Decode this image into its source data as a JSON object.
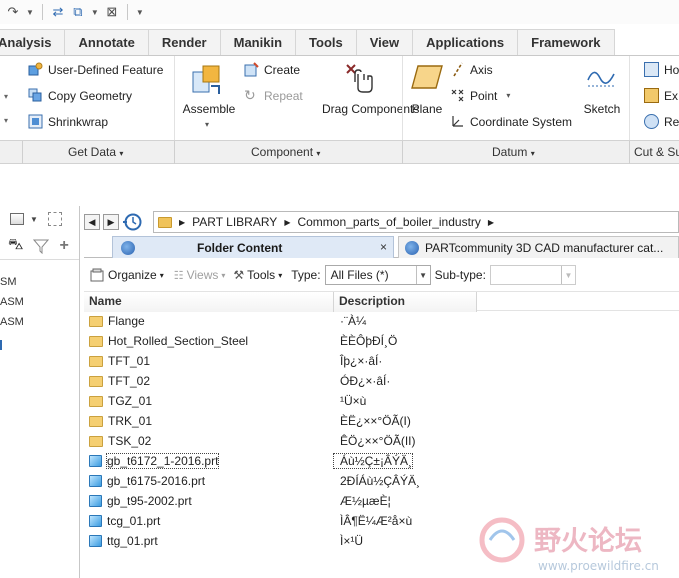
{
  "ribbon_tabs": [
    "Analysis",
    "Annotate",
    "Render",
    "Manikin",
    "Tools",
    "View",
    "Applications",
    "Framework"
  ],
  "ribbon": {
    "get_data": [
      "User-Defined Feature",
      "Copy Geometry",
      "Shrinkwrap"
    ],
    "assemble": "Assemble",
    "create": "Create",
    "repeat": "Repeat",
    "drag_components": "Drag Components",
    "plane": "Plane",
    "axis": "Axis",
    "point": "Point",
    "coordinate_system": "Coordinate System",
    "sketch": "Sketch",
    "right_items": [
      "Ho",
      "Ex",
      "Re"
    ]
  },
  "groups": {
    "get_data": "Get Data",
    "component": "Component",
    "datum": "Datum",
    "cut_surface": "Cut & Su"
  },
  "left_panel": {
    "items": [
      "SM",
      "ASM",
      "ASM"
    ]
  },
  "nav": {
    "path": [
      "PART LIBRARY",
      "Common_parts_of_boiler_industry"
    ]
  },
  "browser_tabs": {
    "tab1": "Folder Content",
    "tab1_close": "×",
    "tab2": "PARTcommunity 3D CAD manufacturer cat..."
  },
  "folder_toolbar": {
    "organize": "Organize",
    "views": "Views",
    "tools": "Tools",
    "type_label": "Type:",
    "type_value": "All Files (*)",
    "subtype_label": "Sub-type:"
  },
  "list": {
    "col_name": "Name",
    "col_desc": "Description",
    "rows": [
      {
        "name": "Flange",
        "desc": "·¨À¼",
        "kind": "folder"
      },
      {
        "name": "Hot_Rolled_Section_Steel",
        "desc": "ÈÈÔþÐÍ¸Ö",
        "kind": "folder"
      },
      {
        "name": "TFT_01",
        "desc": "Îþ¿×·âÍ·",
        "kind": "folder"
      },
      {
        "name": "TFT_02",
        "desc": "ÓÐ¿×·âÍ·",
        "kind": "folder"
      },
      {
        "name": "TGZ_01",
        "desc": "¹Ü×ù",
        "kind": "folder"
      },
      {
        "name": "TRK_01",
        "desc": "ÈË¿××°ÖÃ(I)",
        "kind": "folder"
      },
      {
        "name": "TSK_02",
        "desc": "ÊÖ¿××°ÖÃ(II)",
        "kind": "folder"
      },
      {
        "name": "gb_t6172_1-2016.prt",
        "desc": "Áù½Ç±¡ÂÝÄ¸",
        "kind": "part",
        "selected": true
      },
      {
        "name": "gb_t6175-2016.prt",
        "desc": "2ÐÍÁù½ÇÂÝÄ¸",
        "kind": "part"
      },
      {
        "name": "gb_t95-2002.prt",
        "desc": "Æ½µæÈ¦",
        "kind": "part"
      },
      {
        "name": "tcg_01.prt",
        "desc": "ÌÂ¶Ë¼Æ²å×ù",
        "kind": "part"
      },
      {
        "name": "ttg_01.prt",
        "desc": "Ì×¹Ü",
        "kind": "part"
      }
    ]
  },
  "watermark": {
    "title": "野火论坛",
    "url": "www.proewildfire.cn"
  }
}
